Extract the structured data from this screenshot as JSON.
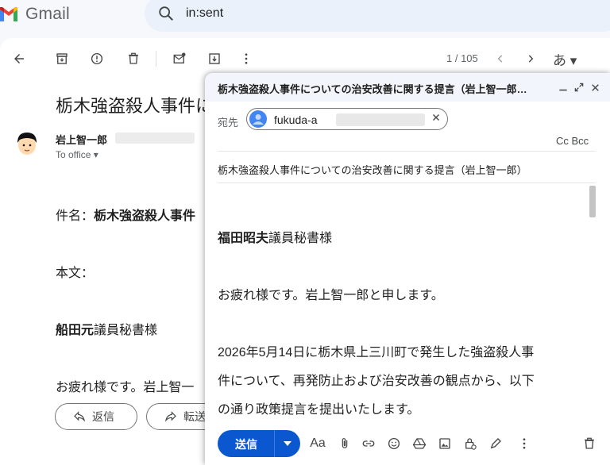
{
  "app": {
    "name": "Gmail"
  },
  "search": {
    "query": "in:sent"
  },
  "toolbar": {
    "pager": "1 / 105",
    "input_tool": "あ ▾"
  },
  "email": {
    "subject": "栃木強盗殺人事件に",
    "sender_name": "岩上智一郎",
    "to_label": "To office ▾",
    "body_lines": [
      "件名：栃木強盗殺人事件",
      "本文：",
      "船田元議員秘書様",
      "お疲れ様です。岩上智一"
    ],
    "reply_label": "返信",
    "forward_label": "転送"
  },
  "compose": {
    "title": "栃木強盗殺人事件についての治安改善に関する提言（岩上智一郎…",
    "to_label": "宛先",
    "recipient": "fukuda-a",
    "ccbcc": "Cc Bcc",
    "subject": "栃木強盗殺人事件についての治安改善に関する提言（岩上智一郎）",
    "greeting_bold": "福田昭夫",
    "greeting_rest": "議員秘書様",
    "line_intro": "お疲れ様です。岩上智一郎と申します。",
    "line_p1": "2026年5月14日に栃木県上三川町で発生した強盗殺人事",
    "line_p2": "件について、再発防止および治安改善の観点から、以下",
    "line_p3": "の通り政策提言を提出いたします。",
    "send_label": "送信",
    "font_label": "Aa"
  },
  "colors": {
    "send": "#0b57d0",
    "search_bg": "#eaf1fb",
    "compose_header": "#f2f6fc"
  },
  "icons": [
    "back-arrow-icon",
    "archive-icon",
    "report-spam-icon",
    "delete-icon",
    "mark-unread-icon",
    "snooze-icon",
    "more-vert-icon",
    "prev-icon",
    "next-icon",
    "minimize-icon",
    "expand-icon",
    "close-icon",
    "attach-icon",
    "link-icon",
    "emoji-icon",
    "drive-icon",
    "photo-icon",
    "lock-icon",
    "signature-icon",
    "trash-icon"
  ]
}
